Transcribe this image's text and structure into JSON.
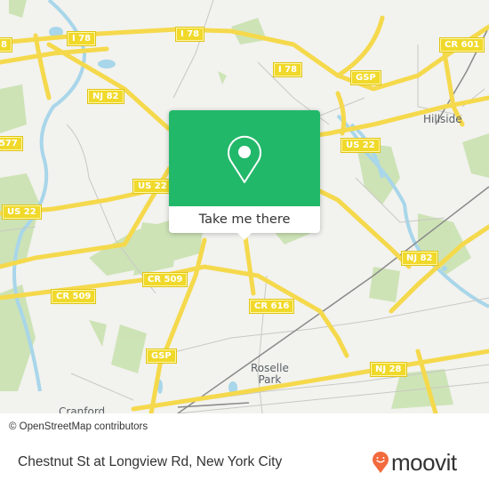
{
  "map": {
    "road_labels": [
      {
        "text": "I 78",
        "id": "i78-west"
      },
      {
        "text": "I 78",
        "id": "i78-center"
      },
      {
        "text": "I 78",
        "id": "i78-east"
      },
      {
        "text": "8",
        "id": "i78-edge"
      },
      {
        "text": "GSP",
        "id": "gsp-north"
      },
      {
        "text": "CR 601",
        "id": "cr601"
      },
      {
        "text": "NJ 82",
        "id": "nj82-west"
      },
      {
        "text": "NJ 82",
        "id": "nj82-east"
      },
      {
        "text": "577",
        "id": "cr577"
      },
      {
        "text": "US 22",
        "id": "us22-west"
      },
      {
        "text": "US 22",
        "id": "us22-center"
      },
      {
        "text": "US 22",
        "id": "us22-east"
      },
      {
        "text": "CR 509",
        "id": "cr509-west"
      },
      {
        "text": "CR 509",
        "id": "cr509-center"
      },
      {
        "text": "CR 616",
        "id": "cr616"
      },
      {
        "text": "GSP",
        "id": "gsp-south"
      },
      {
        "text": "NJ 28",
        "id": "nj28"
      }
    ],
    "place_labels": {
      "hillside": "Hillside",
      "roselle_park": "Roselle\nPark",
      "cranford": "Cranford"
    },
    "attribution": "© OpenStreetMap contributors"
  },
  "popup": {
    "icon": "map-pin-icon",
    "button_label": "Take me there",
    "accent_color": "#22b86a"
  },
  "footer": {
    "location_title": "Chestnut St at Longview Rd, New York City",
    "logo_text": "moovit",
    "logo_color": "#f26a3d"
  }
}
